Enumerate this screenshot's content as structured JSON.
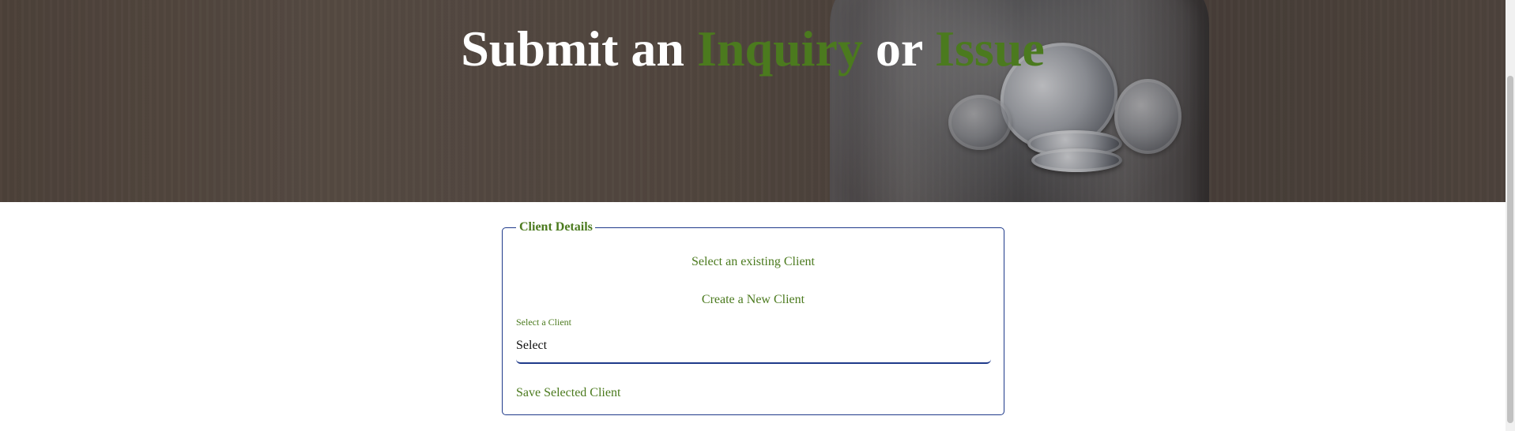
{
  "hero": {
    "title_part1": "Submit an ",
    "title_accent1": "Inquiry",
    "title_part2": " or ",
    "title_accent2": "Issue",
    "accent_color": "#4b7a1e"
  },
  "client_details": {
    "legend": "Client Details",
    "option_existing": "Select an existing Client",
    "option_new": "Create a New Client",
    "select_label": "Select a Client",
    "select_value": "Select",
    "save_label": "Save Selected Client",
    "border_color": "#1f3a8a"
  }
}
